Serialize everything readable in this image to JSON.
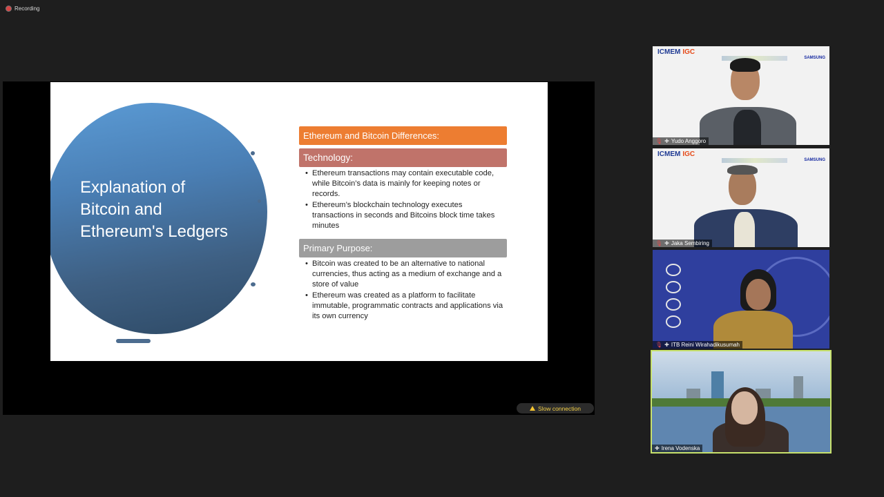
{
  "recording": {
    "label": "Recording"
  },
  "slide": {
    "title": "Explanation of Bitcoin and Ethereum's Ledgers",
    "header_orange": "Ethereum and Bitcoin Differences:",
    "section1_title": "Technology:",
    "section1_bullets": [
      "Ethereum transactions may contain executable code, while Bitcoin’s data is mainly for keeping notes or records.",
      "Ethereum’s blockchain technology executes transactions in seconds and Bitcoins block time takes minutes"
    ],
    "section2_title": "Primary Purpose:",
    "section2_bullets": [
      "Bitcoin was created to be an alternative to national currencies, thus acting as a medium of exchange and a store of value",
      "Ethereum was created as a platform to facilitate immutable, programmatic contracts and applications via its own currency"
    ]
  },
  "status": {
    "slow_connection": "Slow connection"
  },
  "participants": [
    {
      "name": "Yudo Anggoro",
      "logo_a": "ICMEM",
      "logo_b": "IGC",
      "sponsor": "SAMSUNG"
    },
    {
      "name": "Jaka Sembiring",
      "logo_a": "ICMEM",
      "logo_b": "IGC",
      "sponsor": "SAMSUNG"
    },
    {
      "name": "ITB Reini Wirahadikusumah"
    },
    {
      "name": "Irena Vodenska"
    }
  ],
  "colors": {
    "orange_bar": "#ed7d31",
    "technology_bar": "#c0736a",
    "purpose_bar": "#9d9d9d",
    "active_speaker_border": "#c8e26c",
    "warning": "#f4d046"
  }
}
